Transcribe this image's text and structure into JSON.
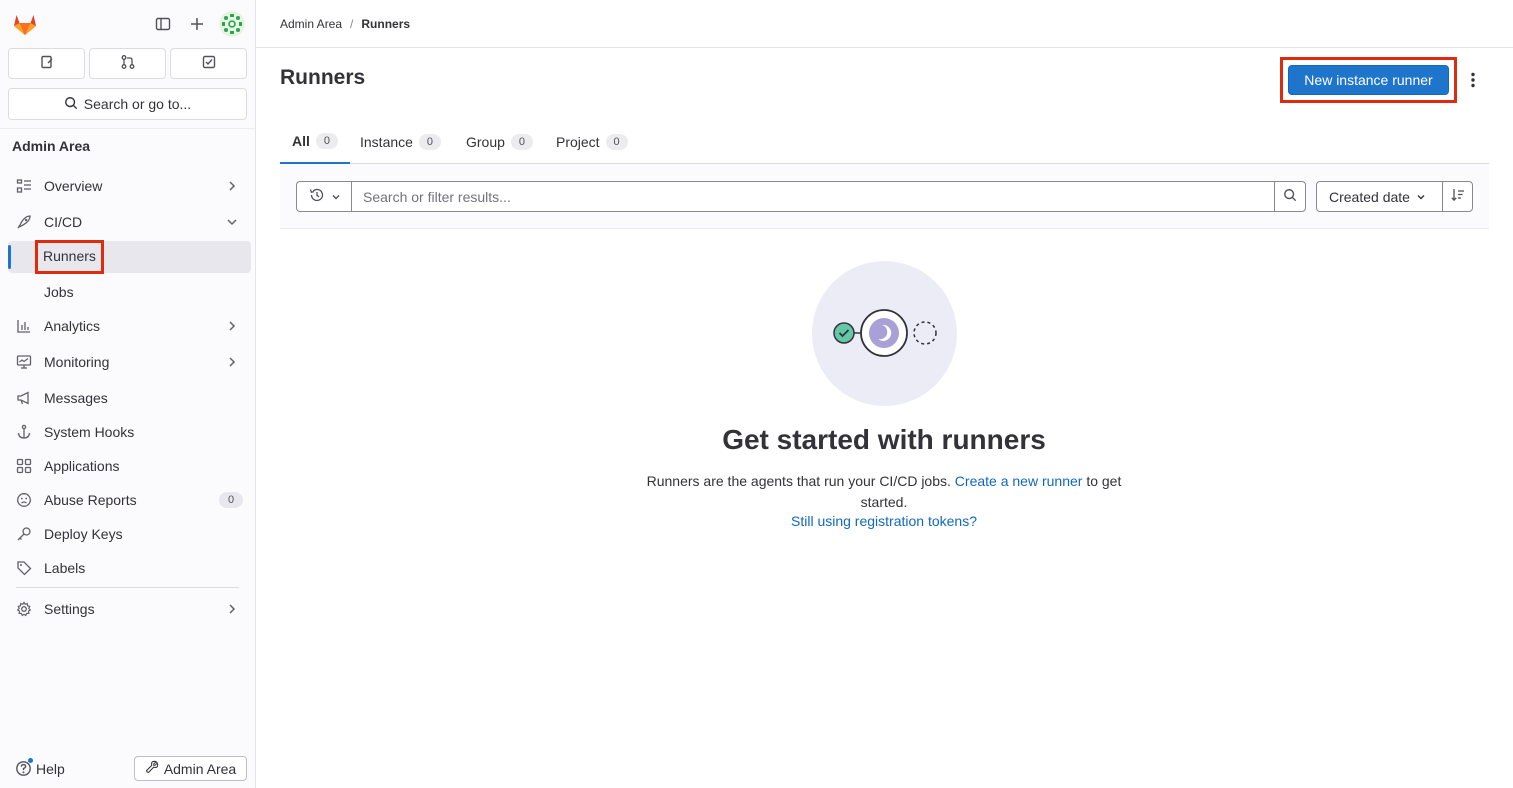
{
  "sidebar": {
    "search_label": "Search or go to...",
    "section_title": "Admin Area",
    "items": [
      {
        "label": "Overview"
      },
      {
        "label": "CI/CD"
      },
      {
        "label": "Runners"
      },
      {
        "label": "Jobs"
      },
      {
        "label": "Analytics"
      },
      {
        "label": "Monitoring"
      },
      {
        "label": "Messages"
      },
      {
        "label": "System Hooks"
      },
      {
        "label": "Applications"
      },
      {
        "label": "Abuse Reports",
        "count": "0"
      },
      {
        "label": "Deploy Keys"
      },
      {
        "label": "Labels"
      },
      {
        "label": "Settings"
      }
    ],
    "help_label": "Help",
    "admin_button_label": "Admin Area"
  },
  "breadcrumb": {
    "parent": "Admin Area",
    "separator": "/",
    "current": "Runners"
  },
  "page": {
    "title": "Runners",
    "new_button_label": "New instance runner"
  },
  "tabs": [
    {
      "label": "All",
      "count": "0"
    },
    {
      "label": "Instance",
      "count": "0"
    },
    {
      "label": "Group",
      "count": "0"
    },
    {
      "label": "Project",
      "count": "0"
    }
  ],
  "filter": {
    "placeholder": "Search or filter results...",
    "sort_label": "Created date"
  },
  "empty_state": {
    "title": "Get started with runners",
    "desc_before": "Runners are the agents that run your CI/CD jobs. ",
    "desc_link": "Create a new runner",
    "desc_after": " to get started.",
    "secondary_link": "Still using registration tokens?"
  },
  "colors": {
    "accent": "#1f75cb",
    "highlight": "#dd2b0e",
    "link": "#1068bf"
  }
}
